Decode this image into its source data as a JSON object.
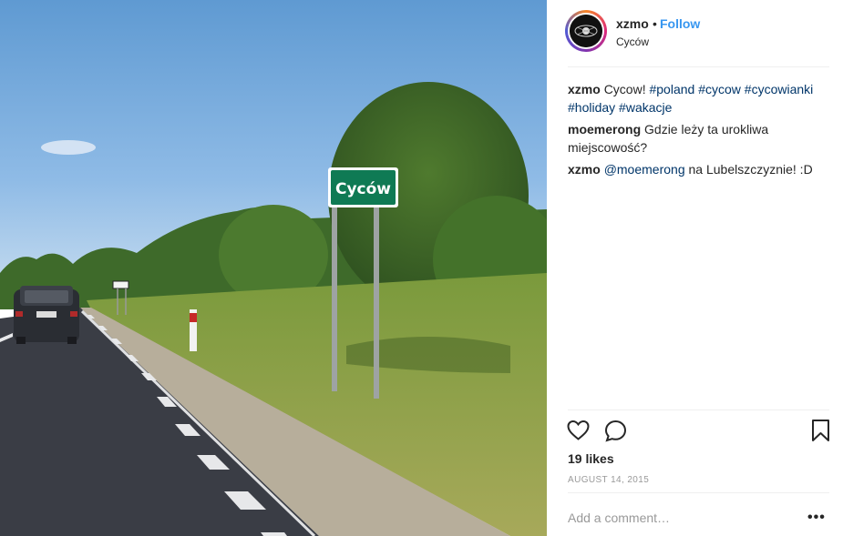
{
  "post": {
    "username": "xzmo",
    "separator": "•",
    "follow_label": "Follow",
    "location": "Cyców",
    "sign_text": "Cyców"
  },
  "comments": [
    {
      "user": "xzmo",
      "text": "Cycow! ",
      "tags": [
        "#poland",
        "#cycow",
        "#cycowianki",
        "#holiday",
        "#wakacje"
      ]
    },
    {
      "user": "moemerong",
      "text": "Gdzie leży ta urokliwa miejscowość?"
    },
    {
      "user": "xzmo",
      "mention": "@moemerong",
      "text": " na Lubelszczyznie! :D"
    }
  ],
  "likes": "19 likes",
  "date": "AUGUST 14, 2015",
  "add_comment_placeholder": "Add a comment…",
  "more_label": "•••",
  "icons": {
    "like": "heart-icon",
    "comment": "speech-bubble-icon",
    "save": "bookmark-icon",
    "more": "ellipsis-icon"
  }
}
